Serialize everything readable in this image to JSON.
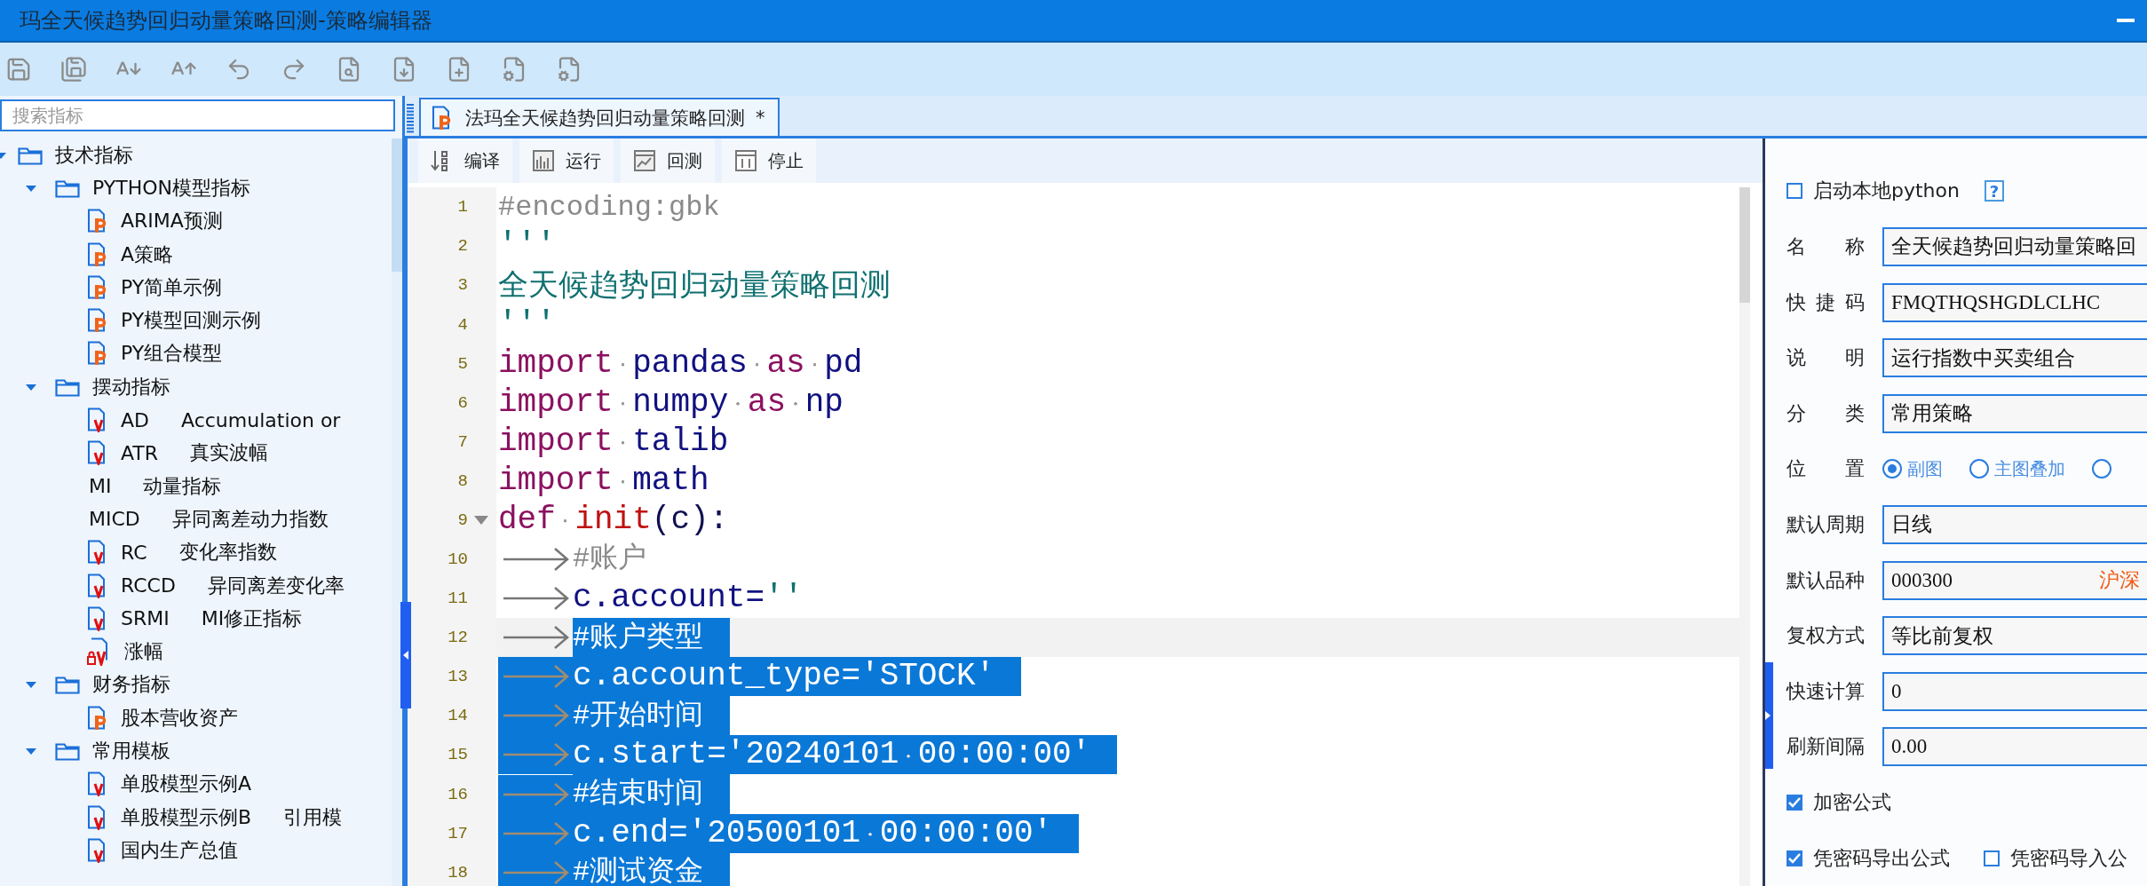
{
  "window": {
    "title": "玛全天候趋势回归动量策略回测-策略编辑器"
  },
  "search": {
    "placeholder": "搜索指标"
  },
  "tree": [
    {
      "kind": "folder",
      "label": "技术指标",
      "expanded": true,
      "children": [
        {
          "kind": "folder",
          "label": "PYTHON模型指标",
          "expanded": true,
          "children": [
            {
              "kind": "python",
              "label": "ARIMA预测"
            },
            {
              "kind": "python",
              "label": "A策略"
            },
            {
              "kind": "python",
              "label": "PY简单示例"
            },
            {
              "kind": "python",
              "label": "PY模型回测示例"
            },
            {
              "kind": "python",
              "label": "PY组合模型"
            }
          ]
        },
        {
          "kind": "folder",
          "label": "摆动指标",
          "expanded": true,
          "children": [
            {
              "kind": "formula",
              "label": "AD",
              "description": "Accumulation or"
            },
            {
              "kind": "formula",
              "label": "ATR",
              "description": "真实波幅"
            },
            {
              "kind": "plain",
              "label": "MI",
              "description": "动量指标"
            },
            {
              "kind": "plain",
              "label": "MICD",
              "description": "异同离差动力指数"
            },
            {
              "kind": "formula",
              "label": "RC",
              "description": "变化率指数"
            },
            {
              "kind": "formula",
              "label": "RCCD",
              "description": "异同离差变化率"
            },
            {
              "kind": "formula",
              "label": "SRMI",
              "description": "MI修正指标"
            },
            {
              "kind": "locked",
              "label": "涨幅"
            }
          ]
        },
        {
          "kind": "folder",
          "label": "财务指标",
          "expanded": true,
          "children": [
            {
              "kind": "python",
              "label": "股本营收资产"
            }
          ]
        },
        {
          "kind": "folder",
          "label": "常用模板",
          "expanded": true,
          "children": [
            {
              "kind": "formula",
              "label": "单股模型示例A"
            },
            {
              "kind": "formula",
              "label": "单股模型示例B",
              "description": "引用模"
            },
            {
              "kind": "formula",
              "label": "国内生产总值"
            }
          ]
        }
      ]
    }
  ],
  "editor": {
    "tabs": [
      {
        "label": "法玛全天候趋势回归动量策略回测",
        "mark": "*",
        "selected": true
      }
    ],
    "actions": [
      {
        "kind": "compile",
        "label": "编译"
      },
      {
        "kind": "run",
        "label": "运行"
      },
      {
        "kind": "backtest",
        "label": "回测"
      },
      {
        "kind": "stop",
        "label": "停止"
      }
    ],
    "lines": [
      {
        "number": "1",
        "tokens": [
          {
            "kind": "comment",
            "text": "#encoding:gbk"
          }
        ]
      },
      {
        "number": "2",
        "tokens": [
          {
            "kind": "string",
            "text": "'''"
          }
        ]
      },
      {
        "number": "3",
        "tokens": [
          {
            "kind": "doc",
            "text": "全天候趋势回归动量策略回测"
          }
        ]
      },
      {
        "number": "4",
        "tokens": [
          {
            "kind": "string",
            "text": "'''"
          }
        ]
      },
      {
        "number": "5",
        "tokens": [
          {
            "kind": "keyword",
            "text": "import"
          },
          {
            "kind": "space"
          },
          {
            "kind": "name",
            "text": "pandas"
          },
          {
            "kind": "space"
          },
          {
            "kind": "keyword",
            "text": "as"
          },
          {
            "kind": "space"
          },
          {
            "kind": "name",
            "text": "pd"
          }
        ]
      },
      {
        "number": "6",
        "tokens": [
          {
            "kind": "keyword",
            "text": "import"
          },
          {
            "kind": "space"
          },
          {
            "kind": "name",
            "text": "numpy"
          },
          {
            "kind": "space"
          },
          {
            "kind": "keyword",
            "text": "as"
          },
          {
            "kind": "space"
          },
          {
            "kind": "name",
            "text": "np"
          }
        ]
      },
      {
        "number": "7",
        "tokens": [
          {
            "kind": "keyword",
            "text": "import"
          },
          {
            "kind": "space"
          },
          {
            "kind": "name",
            "text": "talib"
          }
        ]
      },
      {
        "number": "8",
        "tokens": [
          {
            "kind": "keyword",
            "text": "import"
          },
          {
            "kind": "space"
          },
          {
            "kind": "name",
            "text": "math"
          }
        ]
      },
      {
        "number": "9",
        "fold": true,
        "tokens": [
          {
            "kind": "keyword",
            "text": "def"
          },
          {
            "kind": "space"
          },
          {
            "kind": "function",
            "text": "init"
          },
          {
            "kind": "punct",
            "text": "(c):"
          }
        ]
      },
      {
        "number": "10",
        "indented": true,
        "tokens": [
          {
            "kind": "comment",
            "text": "#账户"
          }
        ]
      },
      {
        "number": "11",
        "indented": true,
        "tokens": [
          {
            "kind": "name",
            "text": "c.account="
          },
          {
            "kind": "string",
            "text": "''"
          }
        ]
      },
      {
        "number": "12",
        "indented": true,
        "current": true,
        "selected": true,
        "indent_selected": false,
        "tokens": [
          {
            "kind": "comment",
            "text": "#账户类型"
          }
        ]
      },
      {
        "number": "13",
        "indented": true,
        "selected": true,
        "indent_selected": true,
        "tokens": [
          {
            "kind": "name",
            "text": "c.account_type="
          },
          {
            "kind": "string",
            "text": "'STOCK'"
          }
        ]
      },
      {
        "number": "14",
        "indented": true,
        "selected": true,
        "indent_selected": true,
        "tokens": [
          {
            "kind": "comment",
            "text": "#开始时间"
          }
        ]
      },
      {
        "number": "15",
        "indented": true,
        "selected": true,
        "indent_selected": true,
        "tokens": [
          {
            "kind": "name",
            "text": "c.start="
          },
          {
            "kind": "string",
            "text": "'20240101"
          },
          {
            "kind": "space"
          },
          {
            "kind": "string",
            "text": "00:00:00'"
          }
        ]
      },
      {
        "number": "16",
        "indented": true,
        "selected": true,
        "indent_selected": true,
        "tokens": [
          {
            "kind": "comment",
            "text": "#结束时间"
          }
        ]
      },
      {
        "number": "17",
        "indented": true,
        "selected": true,
        "indent_selected": true,
        "tokens": [
          {
            "kind": "name",
            "text": "c.end="
          },
          {
            "kind": "string",
            "text": "'20500101"
          },
          {
            "kind": "space"
          },
          {
            "kind": "string",
            "text": "00:00:00'"
          }
        ]
      },
      {
        "number": "18",
        "indented": true,
        "selected": true,
        "indent_selected": true,
        "tokens": [
          {
            "kind": "comment",
            "text": "#测试资金"
          }
        ]
      }
    ]
  },
  "properties": [
    {
      "kind": "checks",
      "items": [
        {
          "label": "启动本地python",
          "checked": false,
          "help": "?"
        }
      ]
    },
    {
      "kind": "field",
      "label": "名称",
      "value": "全天候趋势回归动量策略回"
    },
    {
      "kind": "field",
      "label": "快捷码",
      "value": "FMQTHQSHGDLCLHC"
    },
    {
      "kind": "field",
      "label": "说明",
      "value": "运行指数中买卖组合"
    },
    {
      "kind": "field",
      "label": "分类",
      "value": "常用策略"
    },
    {
      "kind": "radio",
      "label": "位置",
      "options": [
        {
          "label": "副图",
          "selected": true
        },
        {
          "label": "主图叠加",
          "selected": false
        },
        {
          "selected": false
        }
      ]
    },
    {
      "kind": "field",
      "label": "默认周期",
      "value": "日线"
    },
    {
      "kind": "field",
      "label": "默认品种",
      "value": "000300",
      "suffix": "沪深"
    },
    {
      "kind": "field",
      "label": "复权方式",
      "value": "等比前复权"
    },
    {
      "kind": "field",
      "label": "快速计算",
      "value": "0"
    },
    {
      "kind": "field",
      "label": "刷新间隔",
      "value": "0.00"
    },
    {
      "kind": "checks",
      "items": [
        {
          "label": "加密公式",
          "checked": true
        }
      ]
    },
    {
      "kind": "checks",
      "items": [
        {
          "label": "凭密码导出公式",
          "checked": true
        },
        {
          "label": "凭密码导入公",
          "checked": false
        }
      ]
    }
  ]
}
